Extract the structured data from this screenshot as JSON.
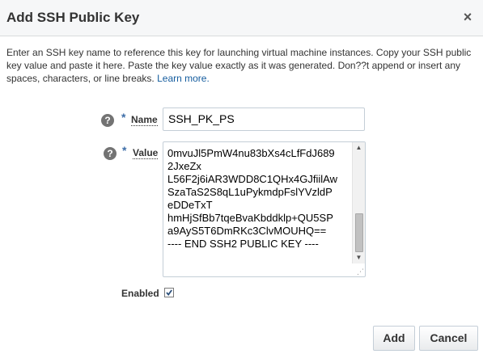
{
  "dialog": {
    "title": "Add SSH Public Key",
    "close_glyph": "×",
    "intro_text": "Enter an SSH key name to reference this key for launching virtual machine instances. Copy your SSH public key value and paste it here. Paste the key value exactly as it was generated. Don??t append or insert any spaces, characters, or line breaks. ",
    "learn_more": "Learn more."
  },
  "form": {
    "help_glyph": "?",
    "required_glyph": "*",
    "name": {
      "label": "Name",
      "value": "SSH_PK_PS"
    },
    "value_field": {
      "label": "Value",
      "text": "- - - - - - - - - - - - - - - - - - -\n0mvuJl5PmW4nu83bXs4cLfFdJ689\n2JxeZx\nL56F2j6iAR3WDD8C1QHx4GJfiilAw\nSzaTaS2S8qL1uPykmdpFslYVzldP\neDDeTxT\nhmHjSfBb7tqeBvaKbddklp+QU5SP\na9AyS5T6DmRKc3ClvMOUHQ==\n---- END SSH2 PUBLIC KEY ----"
    },
    "enabled": {
      "label": "Enabled",
      "checked": true
    }
  },
  "buttons": {
    "add": "Add",
    "cancel": "Cancel"
  },
  "colors": {
    "link": "#145c9e",
    "required_star": "#3e6ea8",
    "header_bg": "#f6f7f8"
  }
}
